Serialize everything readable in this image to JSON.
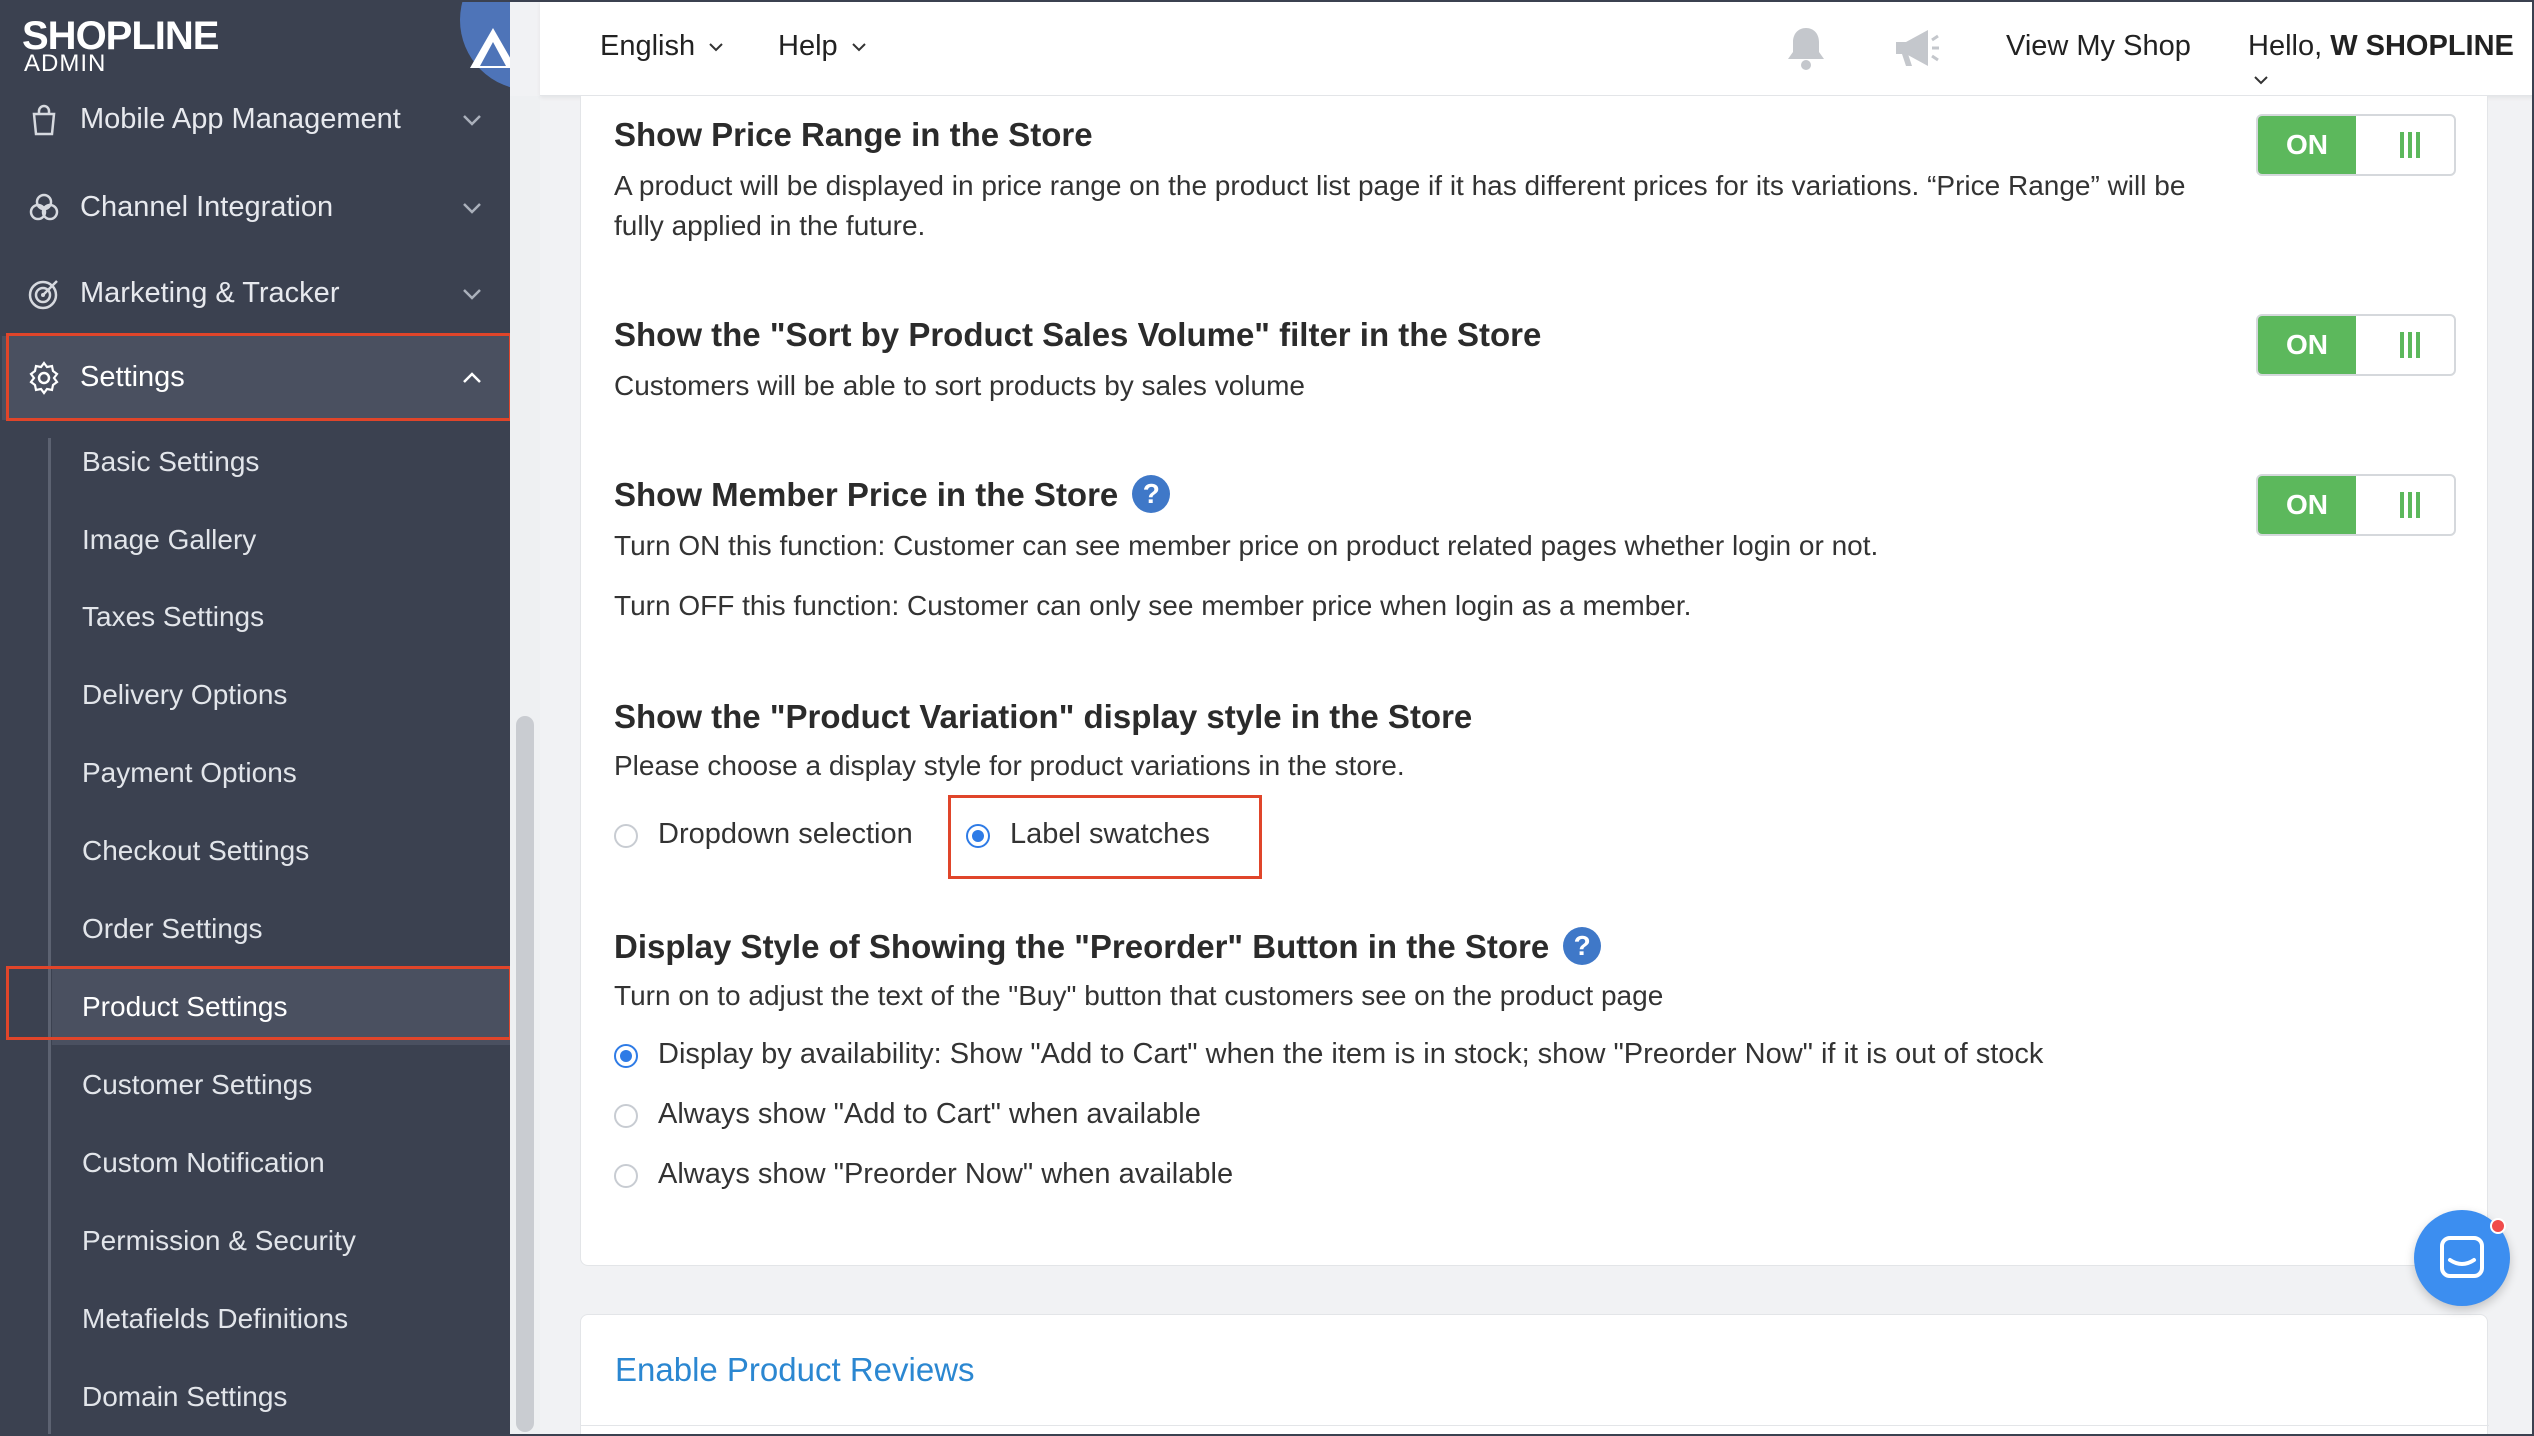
{
  "brand": {
    "name": "SHOPLINE",
    "sub": "ADMIN"
  },
  "sidebar": {
    "top_items": [
      {
        "label": "Mobile App Management",
        "icon": "bag-icon"
      },
      {
        "label": "Channel Integration",
        "icon": "channels-icon"
      },
      {
        "label": "Marketing & Tracker",
        "icon": "target-icon"
      },
      {
        "label": "Settings",
        "icon": "gear-icon"
      }
    ],
    "sub_items": [
      "Basic Settings",
      "Image Gallery",
      "Taxes Settings",
      "Delivery Options",
      "Payment Options",
      "Checkout Settings",
      "Order Settings",
      "Product Settings",
      "Customer Settings",
      "Custom Notification",
      "Permission & Security",
      "Metafields Definitions",
      "Domain Settings"
    ]
  },
  "topbar": {
    "language": "English",
    "help": "Help",
    "view_shop": "View My Shop",
    "greeting": "Hello, ",
    "user": "W SHOPLINE"
  },
  "sections": {
    "price_range": {
      "title": "Show Price Range in the Store",
      "desc": "A product will be displayed in price range on the product list page if it has different prices for its variations. “Price Range” will be fully applied in the future.",
      "toggle": "ON"
    },
    "sort_sales": {
      "title": "Show the \"Sort by Product Sales Volume\" filter in the Store",
      "desc": "Customers will be able to sort products by sales volume",
      "toggle": "ON"
    },
    "member_price": {
      "title": "Show Member Price in the Store",
      "desc_on": "Turn ON this function: Customer can see member price on product related pages whether login or not.",
      "desc_off": "Turn OFF this function: Customer can only see member price when login as a member.",
      "toggle": "ON",
      "help": "?"
    },
    "variation": {
      "title": "Show the \"Product Variation\" display style in the Store",
      "desc": "Please choose a display style for product variations in the store.",
      "options": [
        "Dropdown selection",
        "Label swatches"
      ],
      "selected": "Label swatches"
    },
    "preorder": {
      "title": "Display Style of Showing the \"Preorder\" Button in the Store",
      "desc": "Turn on to adjust the text of the \"Buy\" button that customers see on the product page",
      "options": [
        "Display by availability: Show \"Add to Cart\" when the item is in stock; show \"Preorder Now\" if it is out of stock",
        "Always show \"Add to Cart\" when available",
        "Always show \"Preorder Now\" when available"
      ],
      "selected": "Display by availability: Show \"Add to Cart\" when the item is in stock; show \"Preorder Now\" if it is out of stock",
      "help": "?"
    }
  },
  "reviews": {
    "label": "Enable Product Reviews"
  },
  "colors": {
    "sidebar_bg": "#3b4150",
    "toggle_on": "#5cb85c",
    "highlight": "#e0452a",
    "link": "#2b87d1",
    "radio": "#2e7be6"
  }
}
